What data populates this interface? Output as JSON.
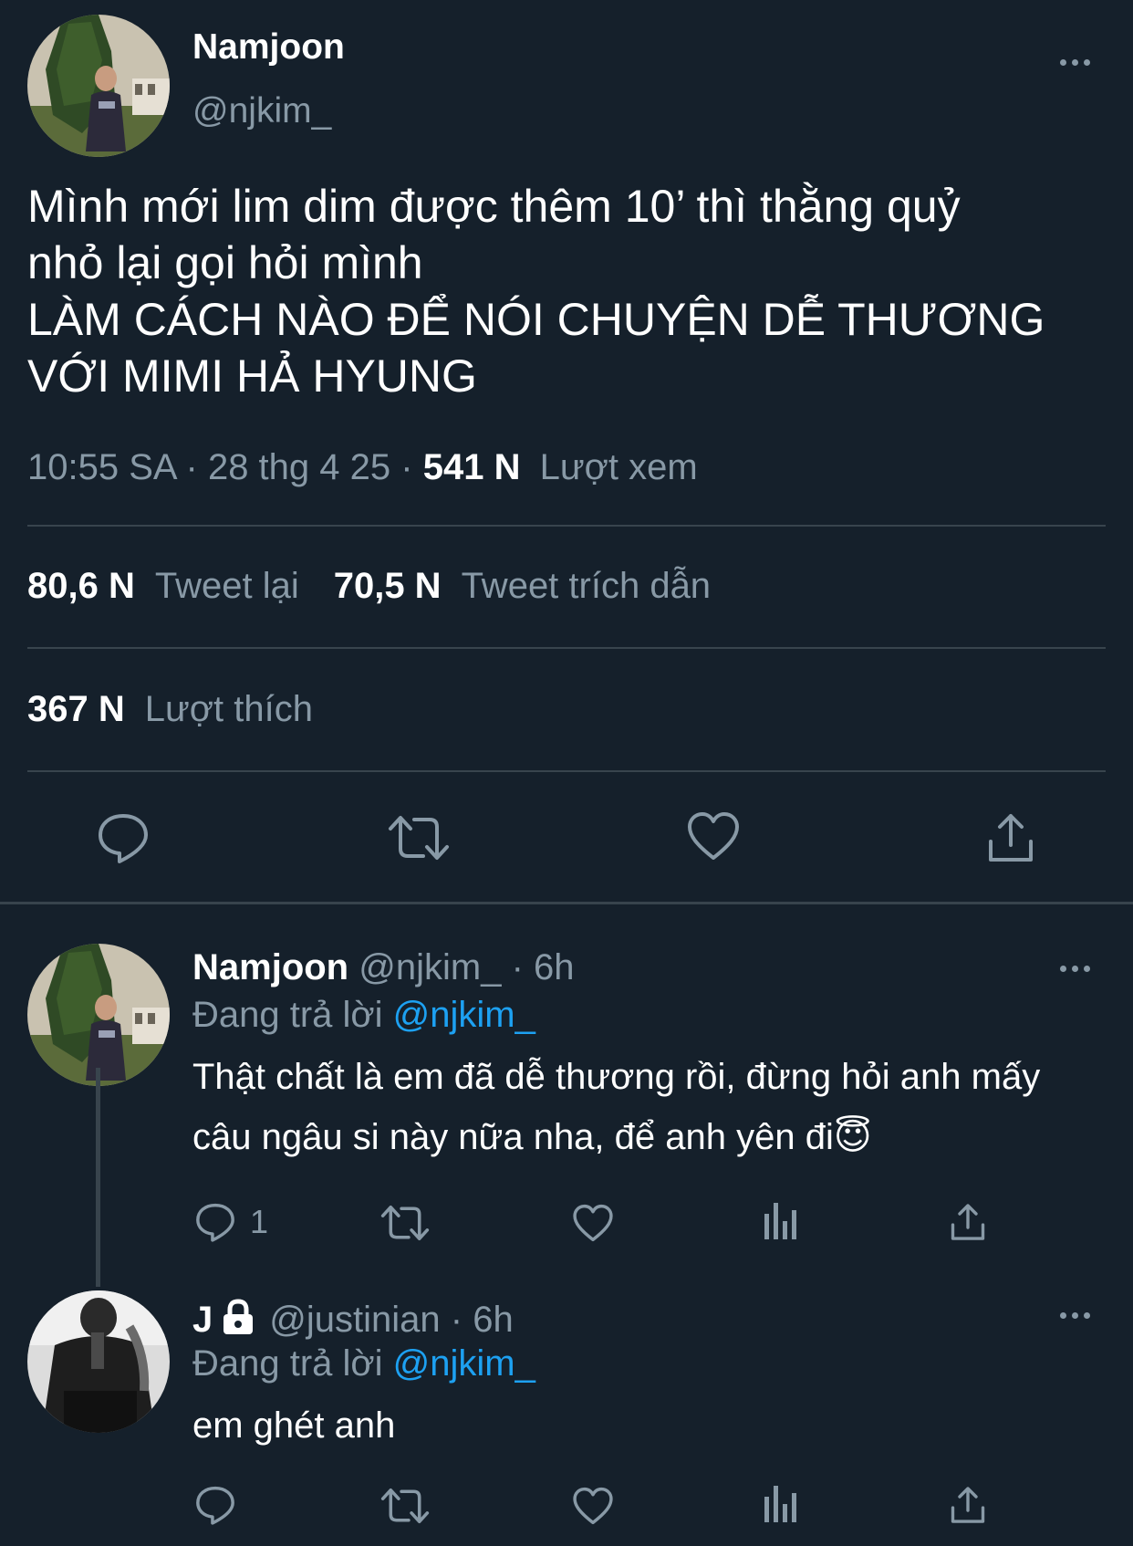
{
  "main_tweet": {
    "display_name": "Namjoon",
    "handle": "@njkim_",
    "text_lines": [
      "Mình mới lim dim được thêm 10’ thì thằng quỷ",
      "nhỏ lại gọi hỏi mình",
      "LÀM CÁCH NÀO ĐỂ NÓI CHUYỆN DỄ THƯƠNG",
      "VỚI MIMI HẢ HYUNG"
    ],
    "time": "10:55 SA",
    "date": "28 thg 4 25",
    "views_count": "541 N",
    "views_label": "Lượt xem",
    "retweets_count": "80,6 N",
    "retweets_label": "Tweet lại",
    "quotes_count": "70,5 N",
    "quotes_label": "Tweet trích dẫn",
    "likes_count": "367 N",
    "likes_label": "Lượt thích"
  },
  "replies": [
    {
      "display_name": "Namjoon",
      "handle": "@njkim_",
      "time": "6h",
      "replying_label": "Đang trả lời",
      "replying_to": "@njkim_",
      "text": "Thật chất là em đã dễ thương rồi, đừng hỏi anh mấy câu ngâu si này nữa nha, để anh yên đi😇",
      "reply_count": "1"
    },
    {
      "display_name": "J",
      "handle": "@justinian",
      "time": "6h",
      "replying_label": "Đang trả lời",
      "replying_to": "@njkim_",
      "text": "em ghét anh",
      "reply_count": ""
    }
  ],
  "separator": "·",
  "colors": {
    "background": "#15202b",
    "secondary_text": "#8899a6",
    "link": "#1da1f2",
    "divider": "#38444d"
  },
  "icons": [
    "more-icon",
    "reply-icon",
    "retweet-icon",
    "like-icon",
    "share-icon",
    "analytics-icon",
    "lock-icon"
  ]
}
